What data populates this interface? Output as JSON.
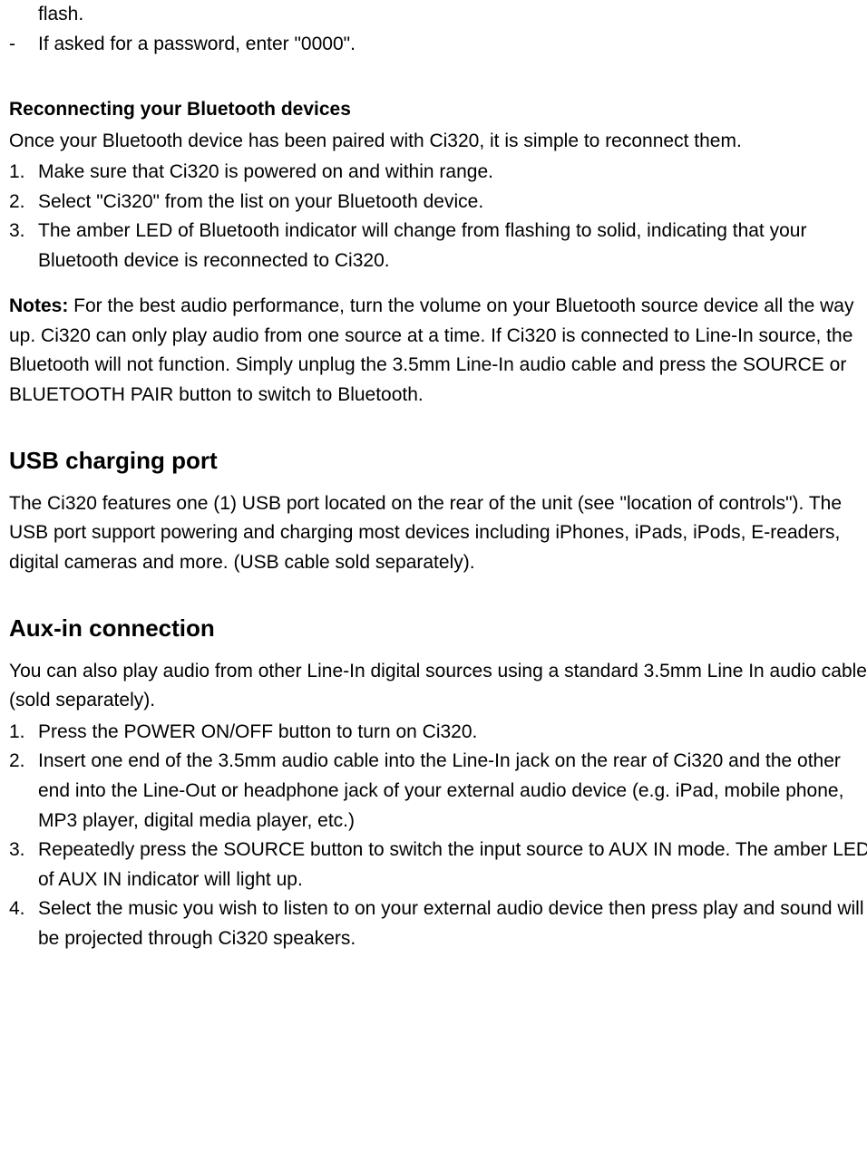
{
  "intro": {
    "flash": "flash.",
    "dash_item": "If asked for a password, enter \"0000\"."
  },
  "reconnect": {
    "heading": "Reconnecting your Bluetooth devices",
    "lead": "Once your Bluetooth device has been paired with Ci320, it is simple to reconnect them.",
    "items": [
      "Make sure that Ci320 is powered on and within range.",
      "Select \"Ci320\" from the list on your Bluetooth device.",
      "The amber LED of Bluetooth indicator will change from flashing to solid, indicating that your Bluetooth device is reconnected to Ci320."
    ]
  },
  "notes": {
    "label": "Notes:",
    "text": " For the best audio performance, turn the volume on your Bluetooth source device all the way up. Ci320 can only play audio from one source at a time.    If Ci320 is connected to Line-In source, the Bluetooth will not function.    Simply unplug the 3.5mm Line-In audio cable and press the SOURCE or BLUETOOTH PAIR button to switch to Bluetooth."
  },
  "usb": {
    "heading": "USB charging port",
    "text": "The Ci320 features one (1) USB port located on the rear of the unit (see \"location of controls\"). The USB port support powering and charging most devices including iPhones, iPads, iPods, E-readers, digital cameras and more. (USB cable sold separately)."
  },
  "aux": {
    "heading": "Aux-in connection",
    "lead": "You can also play audio from other Line-In digital sources using a standard 3.5mm Line In audio cable (sold separately).",
    "items": [
      "Press the POWER ON/OFF button to turn on Ci320.",
      "Insert one end of the 3.5mm audio cable into the Line-In jack on the rear of Ci320 and the other end into the Line-Out or headphone jack of your external audio device (e.g. iPad, mobile phone, MP3 player, digital media player, etc.)",
      "Repeatedly press the SOURCE button to switch the input source to AUX IN mode. The amber LED of AUX IN indicator will light up.",
      "Select the music you wish to listen to on your external audio device then press play and sound will be projected through Ci320 speakers."
    ]
  }
}
